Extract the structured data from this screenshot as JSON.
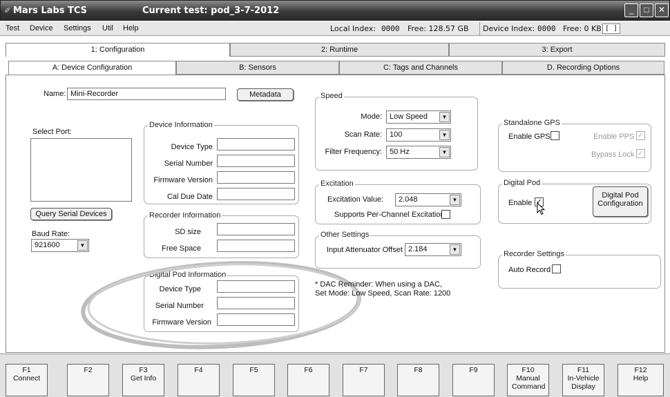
{
  "window": {
    "title": "Mars Labs TCS",
    "test_label": "Current test: pod_3-7-2012"
  },
  "menu": [
    "Test",
    "Device",
    "Settings",
    "Util",
    "Help"
  ],
  "status": {
    "local_index_label": "Local Index:",
    "local_index": "0000",
    "local_free": "Free: 128.57 GB",
    "device_index_label": "Device Index:",
    "device_index": "0000",
    "device_free": "Free: 0 KB",
    "indicator": "[ ]"
  },
  "main_tabs": [
    "1: Configuration",
    "2: Runtime",
    "3: Export"
  ],
  "sub_tabs": [
    "A: Device Configuration",
    "B: Sensors",
    "C: Tags and Channels",
    "D. Recording Options"
  ],
  "config": {
    "name_label": "Name:",
    "name_value": "Mini-Recorder",
    "metadata_button": "Metadata",
    "select_port_label": "Select Port:",
    "query_button": "Query Serial Devices",
    "baud_label": "Baud Rate:",
    "baud_value": "921600",
    "device_info": {
      "legend": "Device Information",
      "fields": [
        "Device Type",
        "Serial Number",
        "Firmware Version",
        "Cal Due Date"
      ]
    },
    "recorder_info": {
      "legend": "Recorder Information",
      "fields": [
        "SD size",
        "Free Space"
      ]
    },
    "pod_info": {
      "legend": "Digital Pod Information",
      "fields": [
        "Device Type",
        "Serial Number",
        "Firmware Version"
      ]
    },
    "speed": {
      "legend": "Speed",
      "mode_label": "Mode:",
      "mode_value": "Low Speed",
      "scan_label": "Scan Rate:",
      "scan_value": "100",
      "filter_label": "Filter Frequency:",
      "filter_value": "50 Hz"
    },
    "excitation": {
      "legend": "Excitation",
      "value_label": "Excitation Value:",
      "value": "2.048",
      "per_channel_label": "Supports Per-Channel Excitation"
    },
    "other": {
      "legend": "Other Settings",
      "atten_label": "Input Attenuator Offset",
      "atten_value": "2.184"
    },
    "note": {
      "line1": "* DAC Reminder: When using a DAC,",
      "line2": "Set Mode: Low Speed, Scan Rate: 1200"
    },
    "gps": {
      "legend": "Standalone GPS",
      "enable_gps": "Enable GPS",
      "enable_pps": "Enable PPS",
      "bypass_lock": "Bypass Lock"
    },
    "digital_pod": {
      "legend": "Digital Pod",
      "enable": "Enable",
      "config_button_line1": "Digital Pod",
      "config_button_line2": "Configuration"
    },
    "recorder_settings": {
      "legend": "Recorder Settings",
      "auto_record": "Auto Record"
    }
  },
  "fkeys": [
    {
      "key": "F1",
      "label": "Connect"
    },
    {
      "key": "F2",
      "label": ""
    },
    {
      "key": "F3",
      "label": "Get Info"
    },
    {
      "key": "F4",
      "label": ""
    },
    {
      "key": "F5",
      "label": ""
    },
    {
      "key": "F6",
      "label": ""
    },
    {
      "key": "F7",
      "label": ""
    },
    {
      "key": "F8",
      "label": ""
    },
    {
      "key": "F9",
      "label": ""
    },
    {
      "key": "F10",
      "label": "Manual Command"
    },
    {
      "key": "F11",
      "label": "In-Vehicle Display"
    },
    {
      "key": "F12",
      "label": "Help"
    }
  ]
}
